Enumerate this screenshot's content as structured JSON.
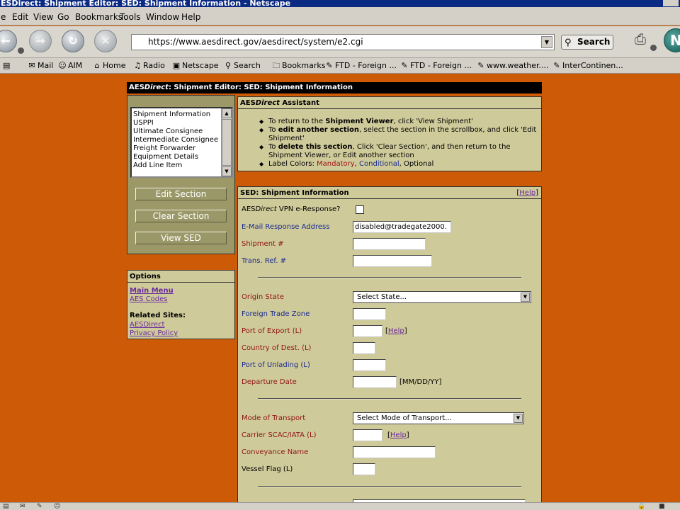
{
  "window": {
    "title": "ESDirect: Shipment Editor: SED: Shipment Information - Netscape"
  },
  "menu": {
    "items": [
      "e",
      "Edit",
      "View",
      "Go",
      "Bookmarks",
      "Tools",
      "Window",
      "Help"
    ]
  },
  "nav": {
    "url": "https://www.aesdirect.gov/aesdirect/system/e2.cgi",
    "search_label": "Search"
  },
  "personal_toolbar": {
    "items": [
      "Mail",
      "AIM",
      "Home",
      "Radio",
      "Netscape",
      "Search",
      "Bookmarks",
      "FTD - Foreign ...",
      "FTD - Foreign ...",
      "www.weather....",
      "InterContinen..."
    ]
  },
  "editor_title": {
    "prefix": "AES",
    "emph": "Direct",
    "rest": ": Shipment Editor: SED: Shipment Information"
  },
  "sections": {
    "items": [
      "Shipment Information",
      "USPPI",
      "Ultimate Consignee",
      "Intermediate Consignee",
      "Freight Forwarder",
      "Equipment Details",
      "Add Line Item"
    ]
  },
  "buttons": {
    "edit_section": "Edit Section",
    "clear_section": "Clear Section",
    "view_sed": "View SED"
  },
  "options": {
    "title": "Options",
    "main_menu": "Main Menu",
    "aes_codes": "AES Codes",
    "related_sites": "Related Sites:",
    "aesdirect": "AESDirect",
    "privacy_policy": "Privacy Policy"
  },
  "assistant": {
    "title_prefix": "AES",
    "title_emph": "Direct",
    "title_rest": " Assistant",
    "i1_a": "To return to the ",
    "i1_b": "Shipment Viewer",
    "i1_c": ", click 'View Shipment'",
    "i2_a": "To ",
    "i2_b": "edit another section",
    "i2_c": ", select the section in the scrollbox, and click 'Edit Shipment'",
    "i3_a": "To ",
    "i3_b": "delete this section",
    "i3_c": ", Click 'Clear Section', and then return to the Shipment Viewer, or Edit another section",
    "i4_a": "Label Colors: ",
    "i4_mandatory": "Mandatory",
    "i4_sep1": ", ",
    "i4_conditional": "Conditional",
    "i4_sep2": ", Optional"
  },
  "sed": {
    "title": "SED: Shipment Information",
    "help": "Help",
    "vpn_prefix": "AES",
    "vpn_emph": "Direct",
    "vpn_rest": " VPN e-Response?",
    "email_label": "E-Mail Response Address",
    "email_value": "disabled@tradegate2000.",
    "shipment_label": "Shipment #",
    "transref_label": "Trans. Ref. #",
    "origin_label": "Origin State",
    "origin_value": "Select State...",
    "ftz_label": "Foreign Trade Zone",
    "poe_label": "Port of Export (L)",
    "cod_label": "Country of Dest. (L)",
    "pou_label": "Port of Unlading (L)",
    "dep_label": "Departure Date",
    "dep_hint": "[MM/DD/YY]",
    "mode_label": "Mode of Transport",
    "mode_value": "Select Mode of Transport...",
    "carrier_label": "Carrier SCAC/IATA (L)",
    "conveyance_label": "Conveyance Name",
    "vessel_label": "Vessel Flag (L)"
  }
}
